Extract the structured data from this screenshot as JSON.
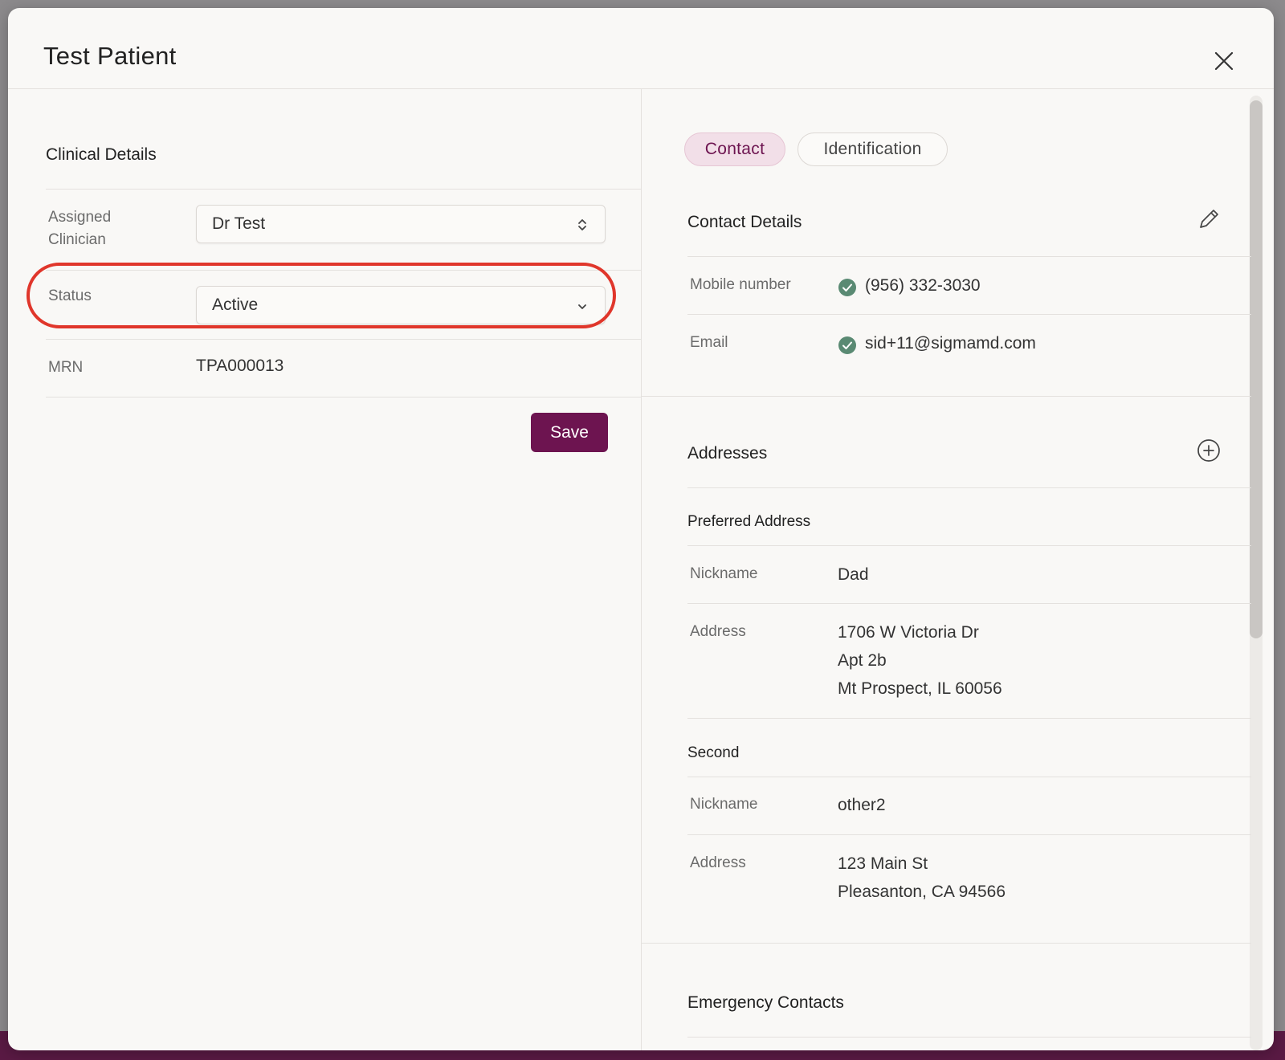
{
  "modal": {
    "title": "Test Patient"
  },
  "clinical": {
    "section_title": "Clinical Details",
    "assigned_clinician_label": "Assigned Clinician",
    "assigned_clinician_value": "Dr Test",
    "status_label": "Status",
    "status_value": "Active",
    "mrn_label": "MRN",
    "mrn_value": "TPA000013",
    "save_label": "Save"
  },
  "tabs": [
    {
      "label": "Contact",
      "active": true
    },
    {
      "label": "Identification",
      "active": false
    }
  ],
  "contact": {
    "section_title": "Contact Details",
    "mobile_label": "Mobile number",
    "mobile_value": "(956) 332-3030",
    "email_label": "Email",
    "email_value": "sid+11@sigmamd.com"
  },
  "addresses": {
    "section_title": "Addresses",
    "preferred": {
      "title": "Preferred Address",
      "nickname_label": "Nickname",
      "nickname_value": "Dad",
      "address_label": "Address",
      "lines": [
        "1706 W Victoria Dr",
        "Apt 2b",
        "Mt Prospect, IL 60056"
      ]
    },
    "second": {
      "title": "Second",
      "nickname_label": "Nickname",
      "nickname_value": "other2",
      "address_label": "Address",
      "lines": [
        "123 Main St",
        "Pleasanton, CA 94566"
      ]
    }
  },
  "emergency": {
    "section_title": "Emergency Contacts"
  },
  "colors": {
    "brand": "#6d1450",
    "tab_active_bg": "#f2dfe8",
    "verified": "#5a8a73",
    "highlight": "#e0362b"
  },
  "icons": {
    "close": "close-icon",
    "edit": "pencil-icon",
    "add": "plus-circle-icon",
    "verified": "check-circle-icon",
    "select_updown": "chevron-up-down-icon",
    "select_down": "chevron-down-icon"
  }
}
